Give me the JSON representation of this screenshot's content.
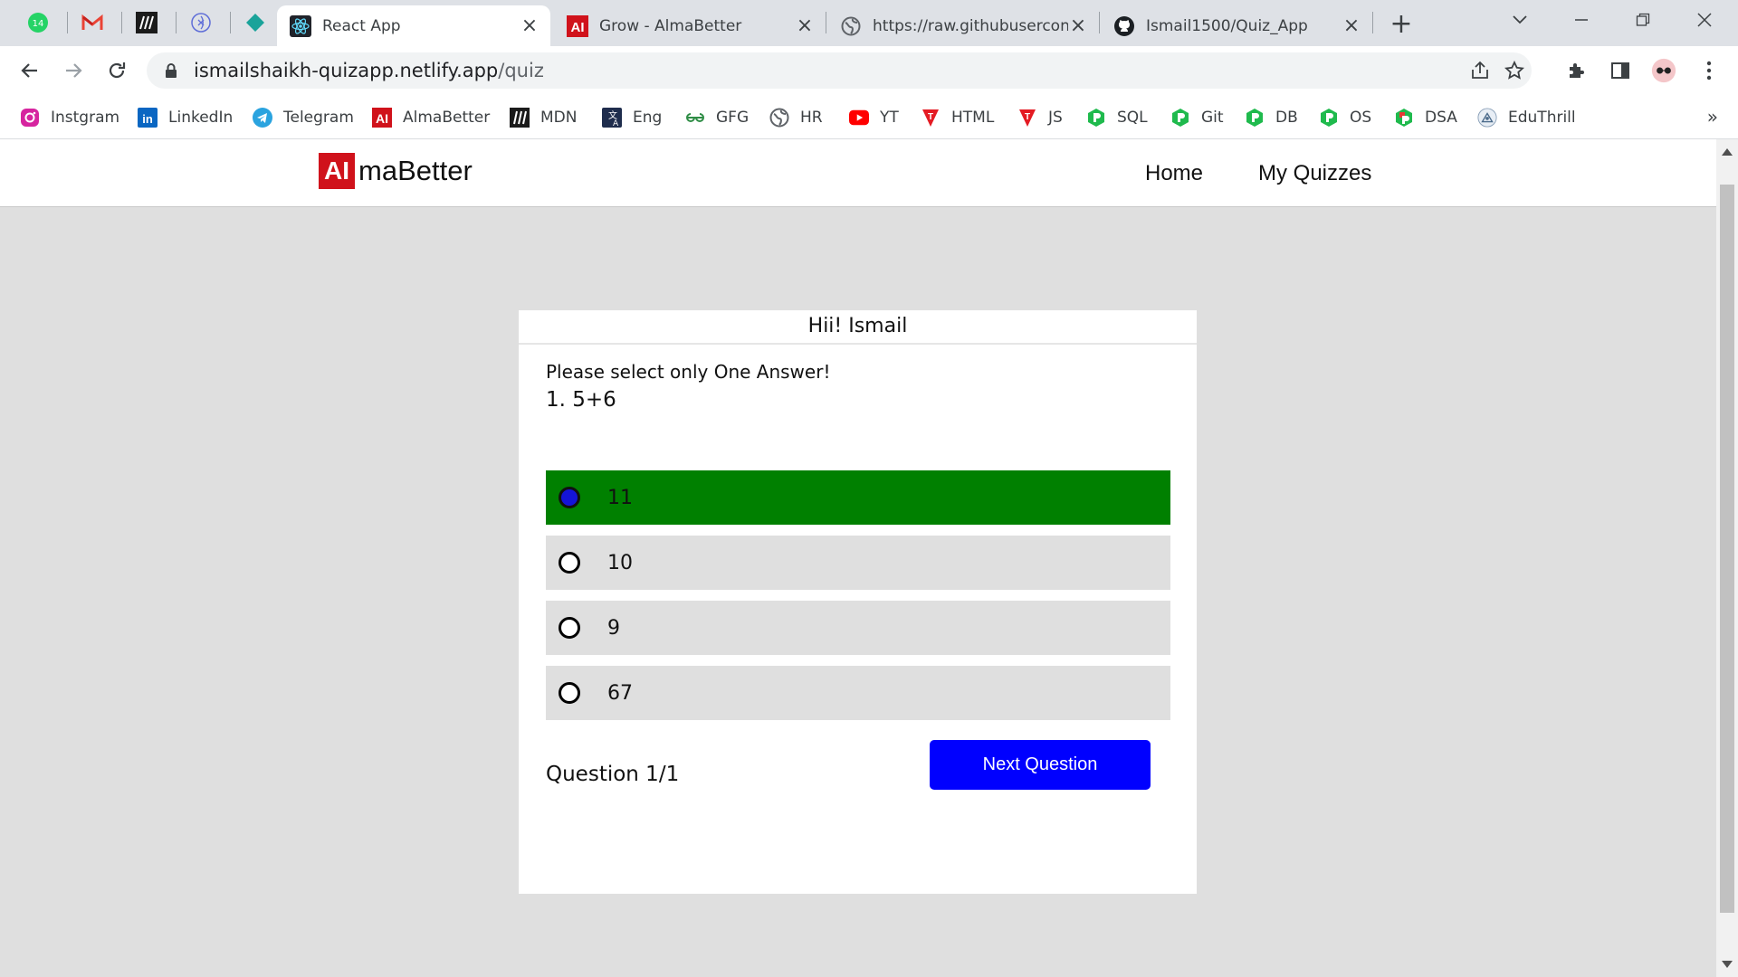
{
  "browser": {
    "tabs": [
      {
        "title": "React App"
      },
      {
        "title": "Grow - AlmaBetter"
      },
      {
        "title": "https://raw.githubusercon"
      },
      {
        "title": "Ismail1500/Quiz_App"
      }
    ],
    "whatsapp_badge": "14",
    "url_host": "ismailshaikh-quizapp.netlify.app",
    "url_path": "/quiz",
    "bookmarks": [
      {
        "label": "Instgram"
      },
      {
        "label": "LinkedIn"
      },
      {
        "label": "Telegram"
      },
      {
        "label": "AlmaBetter"
      },
      {
        "label": "MDN"
      },
      {
        "label": "Eng"
      },
      {
        "label": "GFG"
      },
      {
        "label": "HR"
      },
      {
        "label": "YT"
      },
      {
        "label": "HTML"
      },
      {
        "label": "JS"
      },
      {
        "label": "SQL"
      },
      {
        "label": "Git"
      },
      {
        "label": "DB"
      },
      {
        "label": "OS"
      },
      {
        "label": "DSA"
      },
      {
        "label": "EduThrill"
      }
    ]
  },
  "site": {
    "logo_mark": "AI",
    "logo_text": "maBetter",
    "nav": {
      "home": "Home",
      "my_quizzes": "My Quizzes"
    }
  },
  "quiz": {
    "greeting": "Hii! Ismail",
    "instruction": "Please select only One Answer!",
    "question": "1. 5+6",
    "options": [
      {
        "label": "11",
        "selected": true
      },
      {
        "label": "10",
        "selected": false
      },
      {
        "label": "9",
        "selected": false
      },
      {
        "label": "67",
        "selected": false
      }
    ],
    "progress": "Question 1/1",
    "next_label": "Next Question"
  },
  "colors": {
    "selected_option": "#008000",
    "next_button": "#0000ff",
    "logo_red": "#d0121b",
    "page_background": "#dfdfdf"
  }
}
